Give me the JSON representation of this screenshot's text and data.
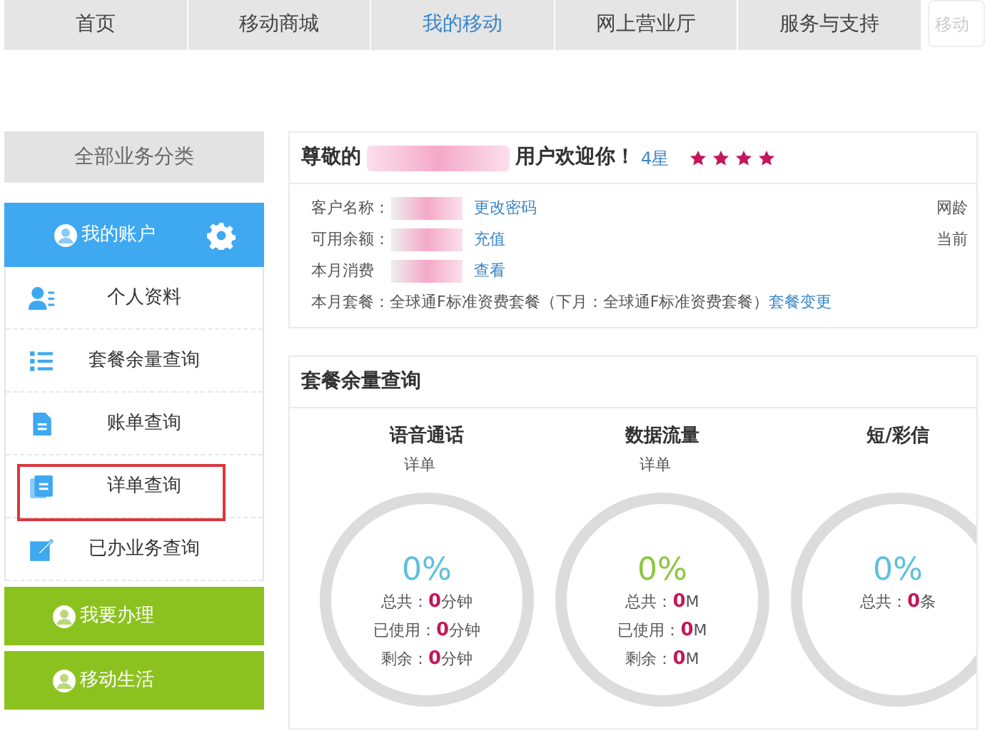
{
  "nav": {
    "items": [
      {
        "label": "首页",
        "selected": false
      },
      {
        "label": "移动商城",
        "selected": false
      },
      {
        "label": "我的移动",
        "selected": true
      },
      {
        "label": "网上营业厅",
        "selected": false
      },
      {
        "label": "服务与支持",
        "selected": false
      }
    ],
    "search": {
      "placeholder": "移动"
    }
  },
  "sidebar": {
    "heading": "全部业务分类",
    "account": {
      "label": "我的账户"
    },
    "items": [
      {
        "label": "个人资料",
        "kind": "profile",
        "highlighted": false
      },
      {
        "label": "套餐余量查询",
        "kind": "list",
        "highlighted": false
      },
      {
        "label": "账单查询",
        "kind": "document",
        "highlighted": false
      },
      {
        "label": "详单查询",
        "kind": "documents",
        "highlighted": true
      },
      {
        "label": "已办业务查询",
        "kind": "edit",
        "highlighted": false
      }
    ],
    "groups": [
      {
        "label": "我要办理"
      },
      {
        "label": "移动生活"
      }
    ]
  },
  "welcome": {
    "prefix": "尊敬的",
    "suffix": "用户欢迎你！",
    "level": "4星",
    "stars": 4,
    "rows": [
      {
        "label": "客户名称：",
        "link": "更改密码"
      },
      {
        "label": "可用余额：",
        "link": "充值"
      },
      {
        "label": "本月消费",
        "link": "查看"
      }
    ],
    "side_labels": [
      "网龄",
      "当前"
    ],
    "plan": {
      "text": "本月套餐：全球通F标准资费套餐（下月：全球通F标准资费套餐）",
      "link": "套餐变更"
    }
  },
  "usage": {
    "title": "套餐余量查询",
    "columns": [
      {
        "title": "语音通话",
        "detail": "详单",
        "percent": "0%",
        "color": "#5bc0de",
        "lines": [
          {
            "label": "总共：",
            "value": "0",
            "unit": "分钟"
          },
          {
            "label": "已使用：",
            "value": "0",
            "unit": "分钟"
          },
          {
            "label": "剩余：",
            "value": "0",
            "unit": "分钟"
          }
        ]
      },
      {
        "title": "数据流量",
        "detail": "详单",
        "percent": "0%",
        "color": "#8cc63f",
        "lines": [
          {
            "label": "总共：",
            "value": "0",
            "unit": "M"
          },
          {
            "label": "已使用：",
            "value": "0",
            "unit": "M"
          },
          {
            "label": "剩余：",
            "value": "0",
            "unit": "M"
          }
        ]
      },
      {
        "title": "短/彩信",
        "percent": "0%",
        "color": "#5bc0de",
        "lines": [
          {
            "label": "总共：",
            "value": "0",
            "unit": "条"
          }
        ]
      }
    ]
  }
}
